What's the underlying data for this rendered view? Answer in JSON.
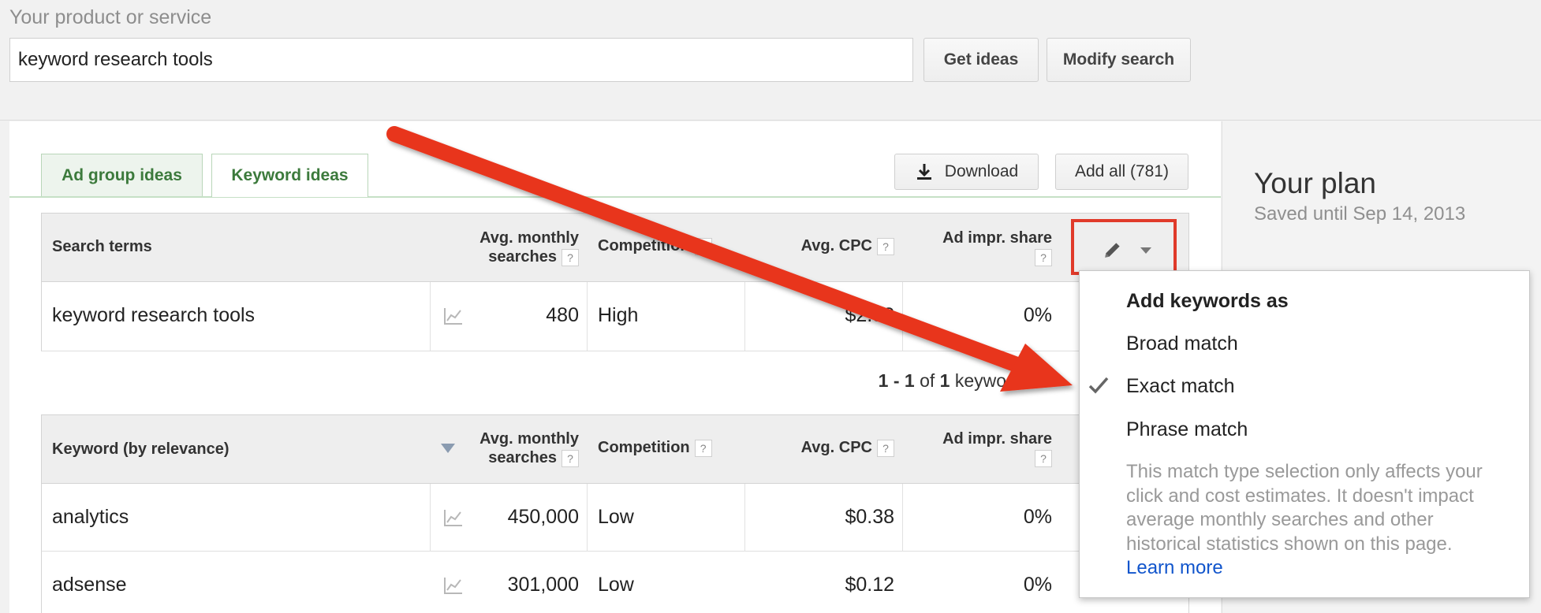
{
  "search": {
    "label": "Your product or service",
    "value": "keyword research tools",
    "get_ideas": "Get ideas",
    "modify": "Modify search"
  },
  "tabs": [
    {
      "label": "Ad group ideas",
      "active": false
    },
    {
      "label": "Keyword ideas",
      "active": true
    }
  ],
  "toolbar": {
    "download": "Download",
    "add_all": "Add all (781)"
  },
  "plan": {
    "title": "Your plan",
    "saved": "Saved until Sep 14, 2013"
  },
  "search_terms_table": {
    "headers": {
      "term": "Search terms",
      "searches_l1": "Avg. monthly",
      "searches_l2": "searches",
      "competition": "Competition",
      "cpc": "Avg. CPC",
      "impr_l1": "Ad impr. share"
    },
    "rows": [
      {
        "term": "keyword research tools",
        "searches": "480",
        "competition": "High",
        "cpc": "$2.38",
        "impr": "0%"
      }
    ]
  },
  "pagination": {
    "range": "1 - 1",
    "of": "of",
    "count": "1",
    "unit": "keywords"
  },
  "keyword_table": {
    "headers": {
      "keyword": "Keyword (by relevance)",
      "searches_l1": "Avg. monthly",
      "searches_l2": "searches",
      "competition": "Competition",
      "cpc": "Avg. CPC",
      "impr_l1": "Ad impr. share"
    },
    "rows": [
      {
        "keyword": "analytics",
        "searches": "450,000",
        "competition": "Low",
        "cpc": "$0.38",
        "impr": "0%"
      },
      {
        "keyword": "adsense",
        "searches": "301,000",
        "competition": "Low",
        "cpc": "$0.12",
        "impr": "0%"
      }
    ]
  },
  "popup": {
    "title": "Add keywords as",
    "items": [
      {
        "label": "Broad match",
        "checked": false
      },
      {
        "label": "Exact match",
        "checked": true
      },
      {
        "label": "Phrase match",
        "checked": false
      }
    ],
    "note": "This match type selection only affects your click and cost estimates. It doesn't impact average monthly searches and other historical statistics shown on this page.",
    "learn_more": "Learn more"
  },
  "icons": {
    "download": "download-icon",
    "trend": "trend-chart-icon",
    "pencil": "pencil-icon",
    "caret": "caret-down-icon",
    "sort": "sort-desc-icon",
    "check": "checkmark-icon",
    "help": "help-icon",
    "arrow": "annotation-arrow"
  },
  "colors": {
    "tab_text": "#3c7a3c",
    "annotation_red": "#e03a2a",
    "link": "#1155cc"
  }
}
